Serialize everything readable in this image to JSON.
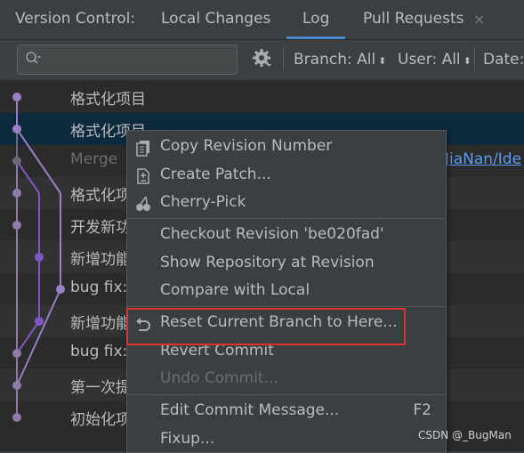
{
  "tabbar": {
    "title": "Version Control:",
    "tabs": [
      {
        "label": "Local Changes"
      },
      {
        "label": "Log"
      },
      {
        "label": "Pull Requests"
      }
    ],
    "close_glyph": "×"
  },
  "toolbar": {
    "search_icon": "search-icon",
    "settings_icon": "gear-icon",
    "filters": [
      {
        "label": "Branch: All"
      },
      {
        "label": "User: All"
      },
      {
        "label": "Date:"
      }
    ]
  },
  "commits": [
    {
      "message": "格式化项目"
    },
    {
      "message": "格式化项目"
    },
    {
      "message": "Merge"
    },
    {
      "message": "格式化项"
    },
    {
      "message": "开发新功"
    },
    {
      "message": "新增功能"
    },
    {
      "message": "bug fix:"
    },
    {
      "message": "新增功能"
    },
    {
      "message": "bug fix:"
    },
    {
      "message": "第一次提"
    },
    {
      "message": "初始化项"
    }
  ],
  "merge_link": "JiaNan/Ide",
  "context_menu": {
    "items": [
      {
        "label": "Copy Revision Number",
        "icon": "copy-icon"
      },
      {
        "label": "Create Patch...",
        "icon": "patch-icon"
      },
      {
        "label": "Cherry-Pick",
        "icon": "cherry-icon"
      },
      {
        "label": "Checkout Revision 'be020fad'"
      },
      {
        "label": "Show Repository at Revision"
      },
      {
        "label": "Compare with Local"
      },
      {
        "label": "Reset Current Branch to Here...",
        "icon": "undo-icon"
      },
      {
        "label": "Revert Commit"
      },
      {
        "label": "Undo Commit..."
      },
      {
        "label": "Edit Commit Message...",
        "shortcut": "F2"
      },
      {
        "label": "Fixup..."
      }
    ]
  },
  "watermark": "CSDN @_BugMan",
  "colors": {
    "accent": "#4a88c7",
    "selection": "#0d293e",
    "highlight_box": "#e0312e",
    "graph_purple_light": "#9a7ec2",
    "graph_purple_dark": "#7e57c2",
    "link": "#589df6"
  }
}
